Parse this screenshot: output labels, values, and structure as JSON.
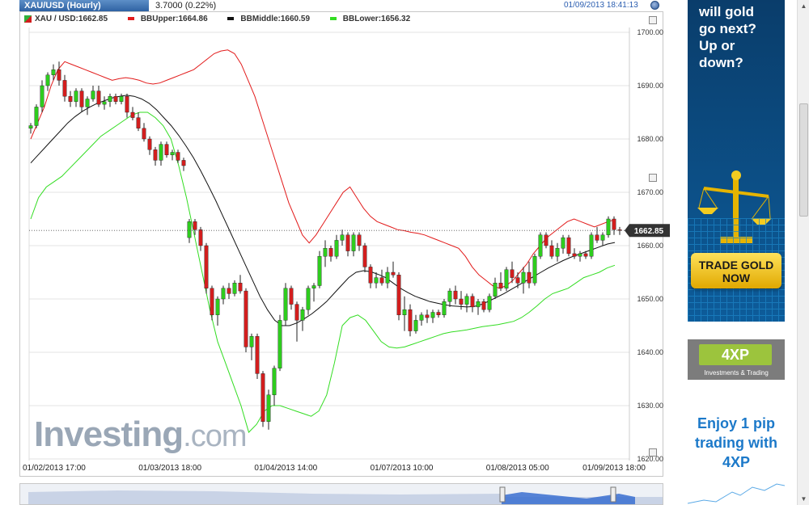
{
  "header": {
    "title": "XAU/USD (Hourly)",
    "change": "3.7000 (0.22%)",
    "timestamp": "01/09/2013 18:41:13"
  },
  "legend": {
    "symbol": "XAU / USD:1662.85",
    "upper": "BBUpper:1664.86",
    "middle": "BBMiddle:1660.59",
    "lower": "BBLower:1656.32"
  },
  "colors": {
    "bull": "#2ecc1e",
    "bear": "#d21e1e",
    "upper": "#e21b1b",
    "middle": "#111111",
    "lower": "#33dd22",
    "accent": "#2f62a3"
  },
  "watermark": {
    "brand": "Investing",
    "suffix": ".com"
  },
  "chart_data": {
    "type": "candlestick",
    "title": "XAU/USD (Hourly)",
    "ylim": [
      1620,
      1700
    ],
    "yticks": [
      "1700.00",
      "1690.00",
      "1680.00",
      "1670.00",
      "1660.00",
      "1650.00",
      "1640.00",
      "1630.00",
      "1620.00"
    ],
    "x_labels": [
      "01/02/2013 17:00",
      "01/03/2013 18:00",
      "01/04/2013 14:00",
      "01/07/2013 10:00",
      "01/08/2013 05:00",
      "01/09/2013 18:00"
    ],
    "last_price": 1662.85,
    "last_price_label": "1662.85",
    "candles": [
      {
        "o": 1682,
        "h": 1683,
        "l": 1681,
        "c": 1682.5
      },
      {
        "o": 1682.5,
        "h": 1686.5,
        "l": 1682,
        "c": 1686
      },
      {
        "o": 1686,
        "h": 1691,
        "l": 1685,
        "c": 1690
      },
      {
        "o": 1690,
        "h": 1692.5,
        "l": 1689,
        "c": 1692
      },
      {
        "o": 1692,
        "h": 1694,
        "l": 1691,
        "c": 1693
      },
      {
        "o": 1693,
        "h": 1694.5,
        "l": 1690,
        "c": 1691
      },
      {
        "o": 1691,
        "h": 1692,
        "l": 1687,
        "c": 1688
      },
      {
        "o": 1688,
        "h": 1689,
        "l": 1686,
        "c": 1687
      },
      {
        "o": 1687,
        "h": 1689.5,
        "l": 1686,
        "c": 1689
      },
      {
        "o": 1689,
        "h": 1689.5,
        "l": 1685,
        "c": 1686
      },
      {
        "o": 1686,
        "h": 1688,
        "l": 1684.5,
        "c": 1687.5
      },
      {
        "o": 1687.5,
        "h": 1690,
        "l": 1687,
        "c": 1689
      },
      {
        "o": 1689,
        "h": 1690,
        "l": 1686,
        "c": 1686.5
      },
      {
        "o": 1686.5,
        "h": 1688,
        "l": 1685.5,
        "c": 1687
      },
      {
        "o": 1687,
        "h": 1688.5,
        "l": 1686,
        "c": 1688
      },
      {
        "o": 1688,
        "h": 1688.5,
        "l": 1686.5,
        "c": 1687
      },
      {
        "o": 1687,
        "h": 1688.5,
        "l": 1686.5,
        "c": 1688
      },
      {
        "o": 1688,
        "h": 1688.5,
        "l": 1684,
        "c": 1685
      },
      {
        "o": 1685,
        "h": 1686,
        "l": 1683.5,
        "c": 1684
      },
      {
        "o": 1684,
        "h": 1685,
        "l": 1681.5,
        "c": 1682
      },
      {
        "o": 1682,
        "h": 1683,
        "l": 1679.5,
        "c": 1680
      },
      {
        "o": 1680,
        "h": 1680.5,
        "l": 1677,
        "c": 1678
      },
      {
        "o": 1678,
        "h": 1678.5,
        "l": 1675,
        "c": 1676
      },
      {
        "o": 1676,
        "h": 1679.5,
        "l": 1675,
        "c": 1679
      },
      {
        "o": 1679,
        "h": 1679.5,
        "l": 1676.5,
        "c": 1677
      },
      {
        "o": 1677,
        "h": 1678,
        "l": 1676,
        "c": 1677.5
      },
      {
        "o": 1677.5,
        "h": 1678,
        "l": 1675.5,
        "c": 1676
      },
      {
        "o": 1676,
        "h": 1676.5,
        "l": 1674,
        "c": 1675
      },
      {
        "o": 1661.5,
        "h": 1665,
        "l": 1660.5,
        "c": 1664.5
      },
      {
        "o": 1664.5,
        "h": 1665,
        "l": 1662,
        "c": 1663
      },
      {
        "o": 1663,
        "h": 1663.5,
        "l": 1659,
        "c": 1660
      },
      {
        "o": 1660,
        "h": 1660.5,
        "l": 1651,
        "c": 1652
      },
      {
        "o": 1652,
        "h": 1652.5,
        "l": 1646,
        "c": 1647
      },
      {
        "o": 1647,
        "h": 1650.5,
        "l": 1645,
        "c": 1650
      },
      {
        "o": 1650,
        "h": 1652.5,
        "l": 1649,
        "c": 1652
      },
      {
        "o": 1652,
        "h": 1653,
        "l": 1650,
        "c": 1651
      },
      {
        "o": 1651,
        "h": 1653.5,
        "l": 1650.5,
        "c": 1653
      },
      {
        "o": 1653,
        "h": 1654.5,
        "l": 1651,
        "c": 1651.5
      },
      {
        "o": 1651.5,
        "h": 1652,
        "l": 1640,
        "c": 1641
      },
      {
        "o": 1641,
        "h": 1643.5,
        "l": 1638.5,
        "c": 1643
      },
      {
        "o": 1643,
        "h": 1643.5,
        "l": 1635,
        "c": 1636
      },
      {
        "o": 1636,
        "h": 1636.5,
        "l": 1626,
        "c": 1627
      },
      {
        "o": 1627,
        "h": 1633,
        "l": 1625.5,
        "c": 1632
      },
      {
        "o": 1632,
        "h": 1637.5,
        "l": 1630,
        "c": 1637
      },
      {
        "o": 1637,
        "h": 1647,
        "l": 1636.5,
        "c": 1646
      },
      {
        "o": 1646,
        "h": 1653,
        "l": 1645,
        "c": 1652
      },
      {
        "o": 1652,
        "h": 1652.5,
        "l": 1648,
        "c": 1649
      },
      {
        "o": 1649,
        "h": 1649.5,
        "l": 1642,
        "c": 1646
      },
      {
        "o": 1646,
        "h": 1648.5,
        "l": 1644,
        "c": 1648
      },
      {
        "o": 1648,
        "h": 1652.5,
        "l": 1647,
        "c": 1652
      },
      {
        "o": 1652,
        "h": 1653,
        "l": 1649.5,
        "c": 1652.5
      },
      {
        "o": 1652.5,
        "h": 1659,
        "l": 1652,
        "c": 1658
      },
      {
        "o": 1658,
        "h": 1661,
        "l": 1656,
        "c": 1659.5
      },
      {
        "o": 1659.5,
        "h": 1660,
        "l": 1657,
        "c": 1658
      },
      {
        "o": 1658,
        "h": 1662,
        "l": 1657.5,
        "c": 1661
      },
      {
        "o": 1661,
        "h": 1663,
        "l": 1660,
        "c": 1662
      },
      {
        "o": 1662,
        "h": 1662.5,
        "l": 1658,
        "c": 1659
      },
      {
        "o": 1659,
        "h": 1662.5,
        "l": 1658,
        "c": 1662
      },
      {
        "o": 1662,
        "h": 1662.5,
        "l": 1659,
        "c": 1660
      },
      {
        "o": 1660,
        "h": 1660.5,
        "l": 1655,
        "c": 1656
      },
      {
        "o": 1656,
        "h": 1656.5,
        "l": 1652,
        "c": 1653
      },
      {
        "o": 1653,
        "h": 1655,
        "l": 1652,
        "c": 1654
      },
      {
        "o": 1654,
        "h": 1655.5,
        "l": 1652.5,
        "c": 1653
      },
      {
        "o": 1653,
        "h": 1656,
        "l": 1652,
        "c": 1655
      },
      {
        "o": 1655,
        "h": 1657,
        "l": 1654,
        "c": 1654.5
      },
      {
        "o": 1654.5,
        "h": 1655,
        "l": 1646,
        "c": 1647
      },
      {
        "o": 1647,
        "h": 1650.5,
        "l": 1644,
        "c": 1648
      },
      {
        "o": 1648,
        "h": 1649,
        "l": 1643,
        "c": 1644
      },
      {
        "o": 1644,
        "h": 1647,
        "l": 1643.5,
        "c": 1646
      },
      {
        "o": 1646,
        "h": 1647.5,
        "l": 1645,
        "c": 1647
      },
      {
        "o": 1647,
        "h": 1648,
        "l": 1645.5,
        "c": 1646.5
      },
      {
        "o": 1646.5,
        "h": 1648,
        "l": 1645.5,
        "c": 1647.5
      },
      {
        "o": 1647.5,
        "h": 1648,
        "l": 1646.5,
        "c": 1647
      },
      {
        "o": 1647,
        "h": 1650,
        "l": 1646.5,
        "c": 1649.5
      },
      {
        "o": 1649.5,
        "h": 1652,
        "l": 1648.5,
        "c": 1651.5
      },
      {
        "o": 1651.5,
        "h": 1652.5,
        "l": 1649,
        "c": 1650
      },
      {
        "o": 1650,
        "h": 1651.5,
        "l": 1648,
        "c": 1649
      },
      {
        "o": 1649,
        "h": 1651,
        "l": 1647.5,
        "c": 1650.5
      },
      {
        "o": 1650.5,
        "h": 1651,
        "l": 1647.5,
        "c": 1648.5
      },
      {
        "o": 1648.5,
        "h": 1650,
        "l": 1647,
        "c": 1649.5
      },
      {
        "o": 1649.5,
        "h": 1650,
        "l": 1647.5,
        "c": 1648
      },
      {
        "o": 1648,
        "h": 1651,
        "l": 1647.5,
        "c": 1650.5
      },
      {
        "o": 1650.5,
        "h": 1654,
        "l": 1650,
        "c": 1653
      },
      {
        "o": 1653,
        "h": 1655,
        "l": 1651.5,
        "c": 1652
      },
      {
        "o": 1652,
        "h": 1656,
        "l": 1651.5,
        "c": 1655.5
      },
      {
        "o": 1655.5,
        "h": 1657,
        "l": 1653,
        "c": 1654
      },
      {
        "o": 1654,
        "h": 1655,
        "l": 1652,
        "c": 1653
      },
      {
        "o": 1653,
        "h": 1656,
        "l": 1651,
        "c": 1655
      },
      {
        "o": 1655,
        "h": 1657,
        "l": 1652,
        "c": 1653
      },
      {
        "o": 1653,
        "h": 1658.5,
        "l": 1652.5,
        "c": 1658
      },
      {
        "o": 1658,
        "h": 1662.5,
        "l": 1657.5,
        "c": 1662
      },
      {
        "o": 1662,
        "h": 1662.5,
        "l": 1659.5,
        "c": 1660
      },
      {
        "o": 1660,
        "h": 1661,
        "l": 1657.5,
        "c": 1658
      },
      {
        "o": 1658,
        "h": 1660.5,
        "l": 1657,
        "c": 1659.5
      },
      {
        "o": 1659.5,
        "h": 1662,
        "l": 1658.5,
        "c": 1661.5
      },
      {
        "o": 1661.5,
        "h": 1662,
        "l": 1658,
        "c": 1658.5
      },
      {
        "o": 1658.5,
        "h": 1659.5,
        "l": 1657.5,
        "c": 1658
      },
      {
        "o": 1658,
        "h": 1659,
        "l": 1657,
        "c": 1658.5
      },
      {
        "o": 1658.5,
        "h": 1659,
        "l": 1657.5,
        "c": 1658
      },
      {
        "o": 1658,
        "h": 1662.5,
        "l": 1657.5,
        "c": 1662
      },
      {
        "o": 1662,
        "h": 1663.5,
        "l": 1660.5,
        "c": 1661
      },
      {
        "o": 1661,
        "h": 1662.5,
        "l": 1660,
        "c": 1662
      },
      {
        "o": 1662,
        "h": 1665.5,
        "l": 1661.5,
        "c": 1665
      },
      {
        "o": 1665,
        "h": 1665.5,
        "l": 1662,
        "c": 1663
      },
      {
        "o": 1663,
        "h": 1663.5,
        "l": 1662,
        "c": 1662.85
      }
    ],
    "bb_upper": [
      1680,
      1683,
      1686,
      1690,
      1693,
      1694.5,
      1694,
      1693.5,
      1693,
      1692.5,
      1692,
      1691.5,
      1691,
      1691.3,
      1691.5,
      1691.3,
      1691,
      1690.5,
      1690.3,
      1690.5,
      1691,
      1691.5,
      1692,
      1692.5,
      1693,
      1694,
      1695,
      1696,
      1696.5,
      1696.7,
      1696,
      1694,
      1691,
      1688,
      1684,
      1680,
      1676,
      1672,
      1668,
      1665,
      1662,
      1660.5,
      1662,
      1664,
      1666,
      1668,
      1670,
      1671,
      1669,
      1667,
      1665.5,
      1664.5,
      1664,
      1663.5,
      1663,
      1662.8,
      1662.5,
      1662.3,
      1662,
      1661.5,
      1661,
      1660.5,
      1660,
      1659.5,
      1658,
      1656,
      1654.5,
      1653.5,
      1652.5,
      1652,
      1652.5,
      1653.5,
      1655,
      1656.5,
      1658.5,
      1660,
      1661.5,
      1662.5,
      1663.5,
      1664.5,
      1665,
      1664.5,
      1664,
      1663.5,
      1664,
      1664.5,
      1664.86
    ],
    "bb_middle": [
      1675.5,
      1677,
      1678.5,
      1680,
      1681.5,
      1683,
      1684.2,
      1685.2,
      1686,
      1686.7,
      1687.2,
      1687.7,
      1688,
      1688.2,
      1688,
      1687.5,
      1686.7,
      1685.5,
      1684,
      1682.5,
      1680.7,
      1678.7,
      1676.5,
      1674,
      1671.3,
      1668.5,
      1665.5,
      1662.5,
      1659.5,
      1656.5,
      1653.5,
      1650.5,
      1648,
      1646,
      1645,
      1645,
      1645.5,
      1646.3,
      1647.2,
      1648.3,
      1649.5,
      1651,
      1652.5,
      1654,
      1655,
      1655.3,
      1655.1,
      1654.6,
      1654,
      1653,
      1652,
      1651.2,
      1650.5,
      1650,
      1649.5,
      1649.2,
      1648.9,
      1648.7,
      1648.6,
      1648.5,
      1648.6,
      1649,
      1649.6,
      1650.3,
      1651,
      1651.8,
      1652.6,
      1653.4,
      1654.2,
      1655,
      1655.8,
      1656.5,
      1657.2,
      1657.8,
      1658.3,
      1658.8,
      1659.3,
      1659.8,
      1660.3,
      1660.59
    ],
    "bb_lower": [
      1665,
      1669,
      1671,
      1672,
      1673,
      1674.5,
      1676,
      1677.5,
      1679,
      1680.5,
      1681.5,
      1682.5,
      1683.5,
      1684.5,
      1685,
      1685,
      1684,
      1682.5,
      1680,
      1675,
      1669,
      1662,
      1655,
      1648,
      1642,
      1638,
      1634,
      1630,
      1625,
      1626.5,
      1629,
      1630,
      1630,
      1629.5,
      1629,
      1628.5,
      1628,
      1629,
      1632,
      1638,
      1645,
      1646.5,
      1647,
      1646,
      1644,
      1642,
      1641,
      1640.8,
      1641,
      1641.5,
      1642,
      1642.5,
      1643,
      1643.5,
      1643.8,
      1644,
      1644.2,
      1644.5,
      1644.8,
      1645,
      1645.2,
      1645.5,
      1645.8,
      1646.5,
      1647.5,
      1648.7,
      1650,
      1651,
      1651.5,
      1652,
      1653,
      1654,
      1654.5,
      1655,
      1655.8,
      1656.32
    ]
  }
}
